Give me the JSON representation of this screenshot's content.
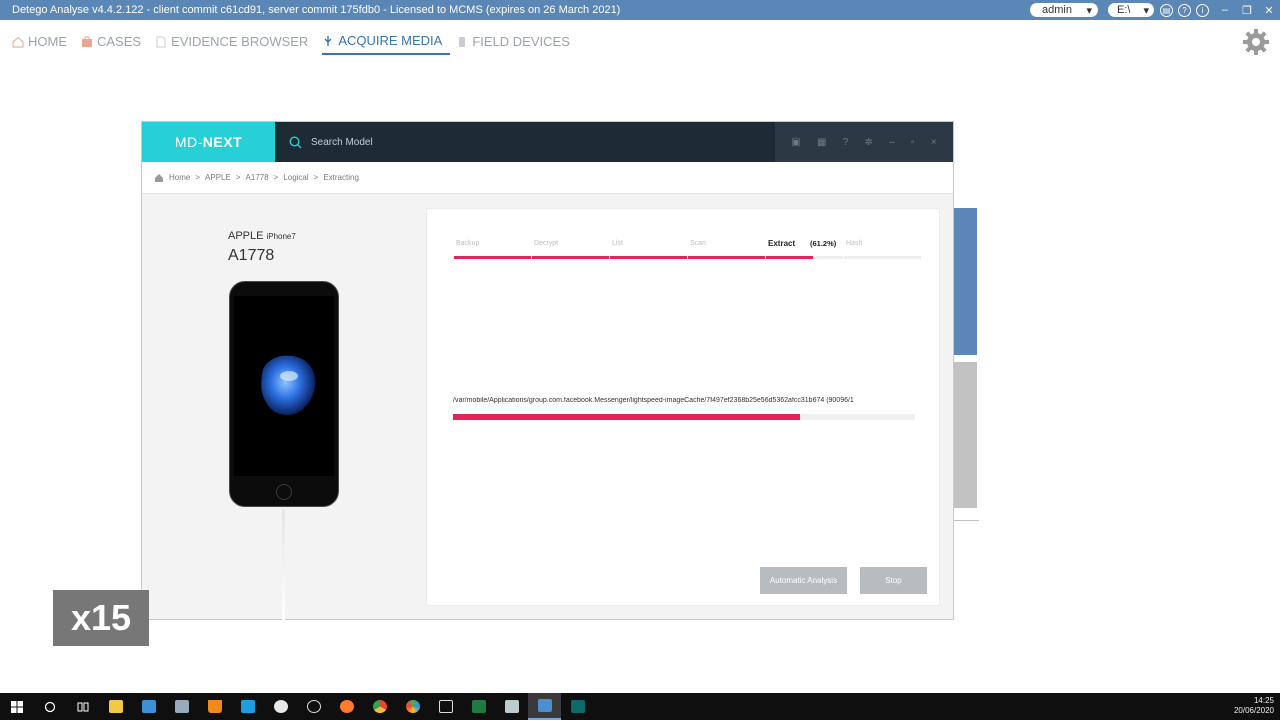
{
  "titlebar": {
    "title": "Detego Analyse v4.4.2.122 - client commit c61cd91, server commit 175fdb0 - Licensed to MCMS (expires on 26 March 2021)",
    "user": "admin",
    "drive": "E:\\"
  },
  "nav": {
    "items": [
      {
        "label": "HOME"
      },
      {
        "label": "CASES"
      },
      {
        "label": "EVIDENCE BROWSER"
      },
      {
        "label": "ACQUIRE MEDIA"
      },
      {
        "label": "FIELD DEVICES"
      }
    ],
    "active": "ACQUIRE MEDIA"
  },
  "mdnext": {
    "logo_left": "MD-",
    "logo_right": "NEXT",
    "search_placeholder": "Search Model",
    "breadcrumb": [
      "Home",
      ">",
      "APPLE",
      ">",
      "A1778",
      ">",
      "Logical",
      ">",
      "Extracting"
    ],
    "device": {
      "brand": "APPLE",
      "model_name": "iPhone7",
      "model": "A1778"
    },
    "steps": [
      {
        "label": "Backup",
        "progress": 1.0
      },
      {
        "label": "Decrypt",
        "progress": 1.0
      },
      {
        "label": "List",
        "progress": 1.0
      },
      {
        "label": "Scan",
        "progress": 1.0
      },
      {
        "label": "Extract",
        "progress": 0.612
      },
      {
        "label": "Hash",
        "progress": 0.0
      }
    ],
    "active_step": "Extract",
    "active_percent": "(61.2%)",
    "file_path": "/var/mobile/Applications/group.com.facebook.Messenger/lightspeed-imageCache/7f497ef2368b25e56d5362afcc31b674 (90096/1",
    "file_progress": 0.75,
    "buttons": {
      "auto": "Automatic Analysis",
      "stop": "Stop"
    }
  },
  "overlay": {
    "speed": "x15"
  },
  "taskbar": {
    "time": "14:25",
    "date": "20/06/2020"
  },
  "colors": {
    "accent": "#3a73ad",
    "progress": "#e3245a",
    "logo": "#27d0d6",
    "titlebar": "#5b87b6"
  }
}
